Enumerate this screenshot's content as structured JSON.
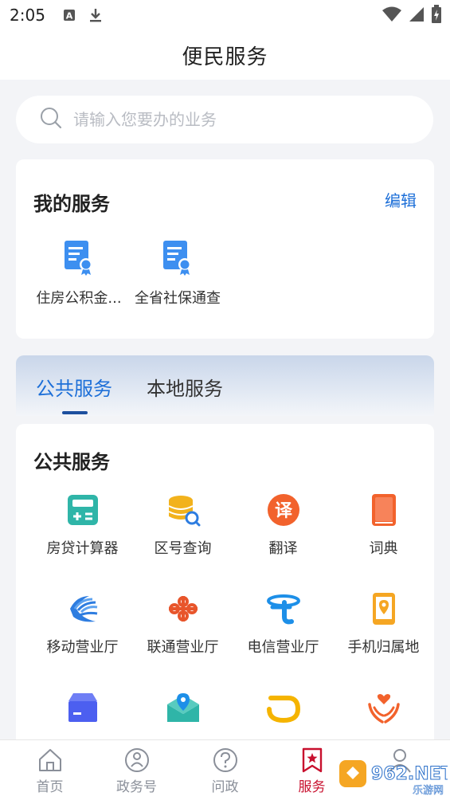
{
  "status_bar": {
    "time": "2:05"
  },
  "header": {
    "title": "便民服务"
  },
  "search": {
    "placeholder": "请输入您要办的业务"
  },
  "my_services": {
    "title": "我的服务",
    "edit_label": "编辑",
    "items": [
      {
        "label": "住房公积金...",
        "icon": "certificate-doc-icon"
      },
      {
        "label": "全省社保通查",
        "icon": "certificate-doc-icon"
      }
    ]
  },
  "tabs": [
    {
      "label": "公共服务",
      "active": true
    },
    {
      "label": "本地服务",
      "active": false
    }
  ],
  "public_services": {
    "title": "公共服务",
    "items": [
      {
        "label": "房贷计算器",
        "icon": "calculator-icon"
      },
      {
        "label": "区号查询",
        "icon": "coin-search-icon"
      },
      {
        "label": "翻译",
        "icon": "translate-icon"
      },
      {
        "label": "词典",
        "icon": "dictionary-icon"
      },
      {
        "label": "移动营业厅",
        "icon": "china-mobile-icon"
      },
      {
        "label": "联通营业厅",
        "icon": "china-unicom-icon"
      },
      {
        "label": "电信营业厅",
        "icon": "china-telecom-icon"
      },
      {
        "label": "手机归属地",
        "icon": "phone-location-icon"
      },
      {
        "label": "",
        "icon": "package-icon"
      },
      {
        "label": "",
        "icon": "map-envelope-icon"
      },
      {
        "label": "",
        "icon": "didi-icon"
      },
      {
        "label": "",
        "icon": "charity-hands-icon"
      }
    ]
  },
  "bottom_nav": [
    {
      "label": "首页",
      "icon": "home-icon",
      "active": false
    },
    {
      "label": "政务号",
      "icon": "government-account-icon",
      "active": false
    },
    {
      "label": "问政",
      "icon": "question-icon",
      "active": false
    },
    {
      "label": "服务",
      "icon": "service-bookmark-icon",
      "active": true
    },
    {
      "label": "",
      "icon": "profile-icon",
      "active": false
    }
  ],
  "watermark": {
    "text": "962.NET",
    "subtext": "乐游网"
  },
  "colors": {
    "accent_blue": "#1d6fd8",
    "active_red": "#c8102e",
    "background": "#f3f4f7"
  }
}
